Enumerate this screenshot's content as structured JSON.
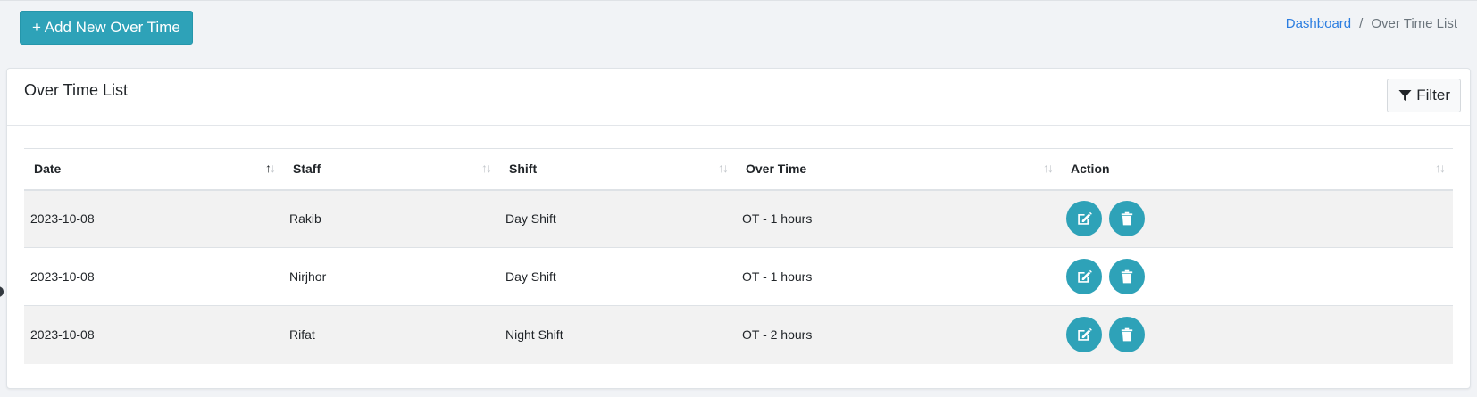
{
  "toolbar": {
    "add_label": "+ Add New Over Time"
  },
  "breadcrumb": {
    "home": "Dashboard",
    "separator": "/",
    "current": "Over Time List"
  },
  "card": {
    "title": "Over Time List",
    "filter_label": "Filter"
  },
  "table": {
    "columns": [
      "Date",
      "Staff",
      "Shift",
      "Over Time",
      "Action"
    ],
    "sort_glyph_up": "↑",
    "sort_glyph_down": "↓",
    "rows": [
      {
        "date": "2023-10-08",
        "staff": "Rakib",
        "shift": "Day Shift",
        "overtime": "OT - 1 hours"
      },
      {
        "date": "2023-10-08",
        "staff": "Nirjhor",
        "shift": "Day Shift",
        "overtime": "OT - 1 hours"
      },
      {
        "date": "2023-10-08",
        "staff": "Rifat",
        "shift": "Night Shift",
        "overtime": "OT - 2 hours"
      }
    ]
  },
  "icons": {
    "edit": "edit-icon",
    "delete": "trash-icon",
    "filter": "filter-icon"
  },
  "colors": {
    "accent": "#2ea2b8",
    "link": "#2b7de0"
  }
}
